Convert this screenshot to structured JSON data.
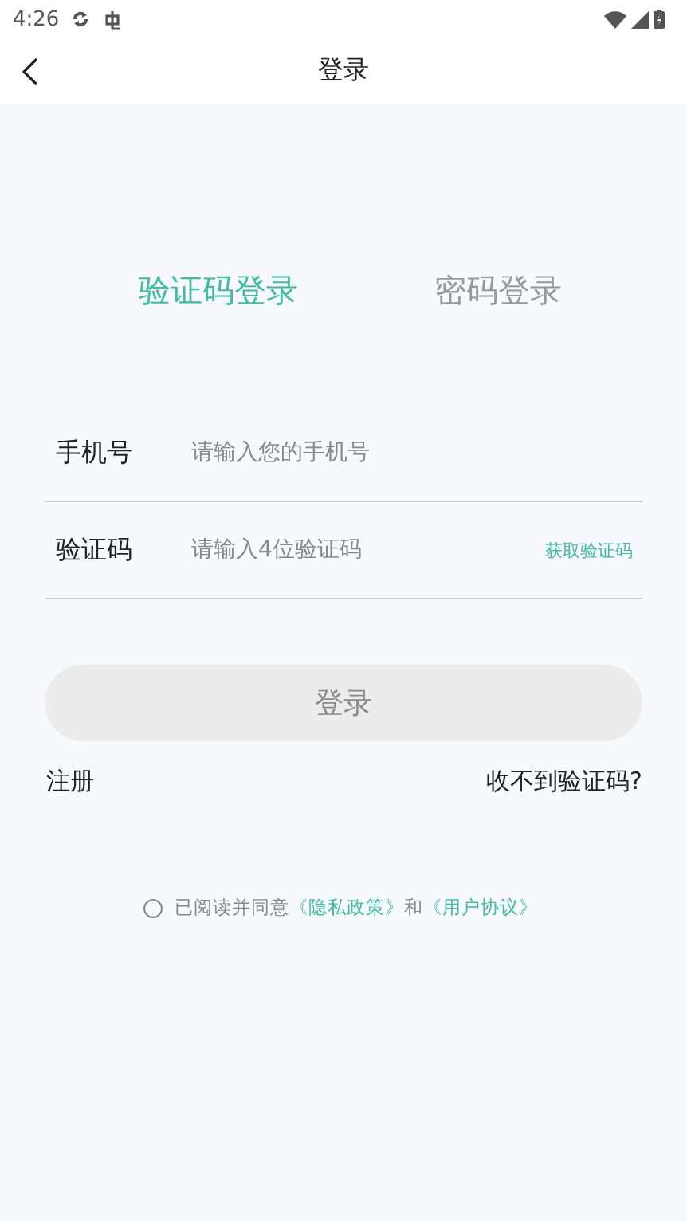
{
  "status_bar": {
    "time": "4:26"
  },
  "nav_bar": {
    "title": "登录"
  },
  "tabs": [
    {
      "label": "验证码登录",
      "selected": true
    },
    {
      "label": "密码登录",
      "selected": false
    }
  ],
  "fields": [
    {
      "label": "手机号",
      "placeholder": "请输入您的手机号"
    },
    {
      "label": "验证码",
      "placeholder": "请输入4位验证码",
      "action": "获取验证码"
    }
  ],
  "login_button": {
    "label": "登录",
    "disabled": true
  },
  "links": {
    "register": "注册",
    "no_code": "收不到验证码?"
  },
  "agreement": {
    "checked": false,
    "text": "已阅读并同意",
    "privacy": "《隐私政策》",
    "and": "和",
    "terms": "《用户协议》"
  }
}
